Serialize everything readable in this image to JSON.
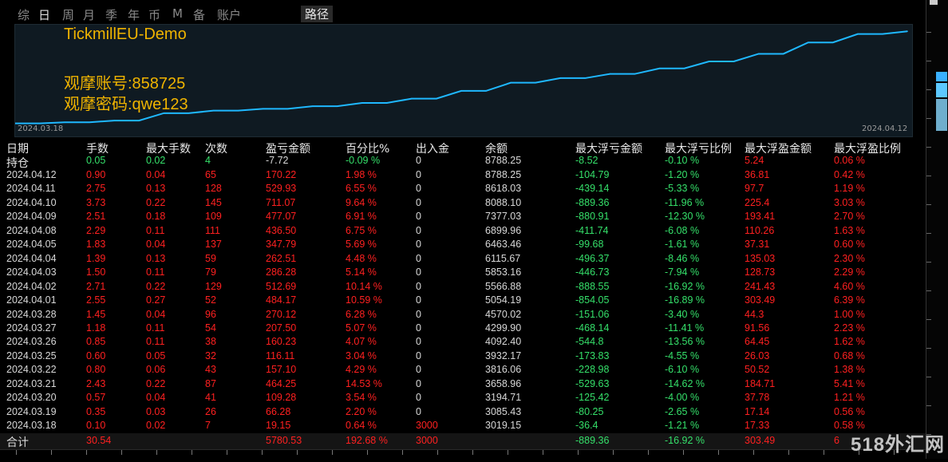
{
  "tabs": [
    "综",
    "日",
    "周",
    "月",
    "季",
    "年",
    "币",
    "M",
    "备",
    "账户"
  ],
  "active_tab": "日",
  "path_tab": "路径",
  "chart": {
    "annotations": [
      "TickmillEU-Demo",
      "观摩账号:858725",
      "观摩密码:qwe123"
    ],
    "start_date": "2024.03.18",
    "end_date": "2024.04.12",
    "line_color": "#1fb8ff",
    "annotation_color": "#f0b400"
  },
  "chart_data": {
    "type": "line",
    "title": "",
    "xlabel": "",
    "ylabel": "",
    "x": [
      "2024.03.18",
      "2024.03.19",
      "2024.03.20",
      "2024.03.21",
      "2024.03.22",
      "2024.03.25",
      "2024.03.26",
      "2024.03.27",
      "2024.03.28",
      "2024.04.01",
      "2024.04.02",
      "2024.04.03",
      "2024.04.04",
      "2024.04.05",
      "2024.04.08",
      "2024.04.09",
      "2024.04.10",
      "2024.04.11",
      "2024.04.12"
    ],
    "series": [
      {
        "values": [
          3019.15,
          3085.43,
          3194.71,
          3658.96,
          3816.06,
          3932.17,
          4092.4,
          4299.9,
          4570.02,
          5054.19,
          5566.88,
          5853.16,
          6115.67,
          6463.46,
          6899.96,
          7377.03,
          8088.1,
          8618.03,
          8788.25
        ]
      }
    ],
    "ylim": [
      2900,
      8900
    ],
    "grid": false
  },
  "table": {
    "headers": [
      "日期",
      "手数",
      "最大手数",
      "次数",
      "盈亏金额",
      "百分比%",
      "出入金",
      "余额",
      "最大浮亏金额",
      "最大浮亏比例",
      "最大浮盈金额",
      "最大浮盈比例"
    ],
    "holding": [
      "持仓",
      "0.05",
      "0.02",
      "4",
      "-7.72",
      "-0.09 %",
      "0",
      "8788.25",
      "-8.52",
      "-0.10 %",
      "5.24",
      "0.06 %"
    ],
    "rows": [
      [
        "2024.04.12",
        "0.90",
        "0.04",
        "65",
        "170.22",
        "1.98 %",
        "0",
        "8788.25",
        "-104.79",
        "-1.20 %",
        "36.81",
        "0.42 %"
      ],
      [
        "2024.04.11",
        "2.75",
        "0.13",
        "128",
        "529.93",
        "6.55 %",
        "0",
        "8618.03",
        "-439.14",
        "-5.33 %",
        "97.7",
        "1.19 %"
      ],
      [
        "2024.04.10",
        "3.73",
        "0.22",
        "145",
        "711.07",
        "9.64 %",
        "0",
        "8088.10",
        "-889.36",
        "-11.96 %",
        "225.4",
        "3.03 %"
      ],
      [
        "2024.04.09",
        "2.51",
        "0.18",
        "109",
        "477.07",
        "6.91 %",
        "0",
        "7377.03",
        "-880.91",
        "-12.30 %",
        "193.41",
        "2.70 %"
      ],
      [
        "2024.04.08",
        "2.29",
        "0.11",
        "111",
        "436.50",
        "6.75 %",
        "0",
        "6899.96",
        "-411.74",
        "-6.08 %",
        "110.26",
        "1.63 %"
      ],
      [
        "2024.04.05",
        "1.83",
        "0.04",
        "137",
        "347.79",
        "5.69 %",
        "0",
        "6463.46",
        "-99.68",
        "-1.61 %",
        "37.31",
        "0.60 %"
      ],
      [
        "2024.04.04",
        "1.39",
        "0.13",
        "59",
        "262.51",
        "4.48 %",
        "0",
        "6115.67",
        "-496.37",
        "-8.46 %",
        "135.03",
        "2.30 %"
      ],
      [
        "2024.04.03",
        "1.50",
        "0.11",
        "79",
        "286.28",
        "5.14 %",
        "0",
        "5853.16",
        "-446.73",
        "-7.94 %",
        "128.73",
        "2.29 %"
      ],
      [
        "2024.04.02",
        "2.71",
        "0.22",
        "129",
        "512.69",
        "10.14 %",
        "0",
        "5566.88",
        "-888.55",
        "-16.92 %",
        "241.43",
        "4.60 %"
      ],
      [
        "2024.04.01",
        "2.55",
        "0.27",
        "52",
        "484.17",
        "10.59 %",
        "0",
        "5054.19",
        "-854.05",
        "-16.89 %",
        "303.49",
        "6.39 %"
      ],
      [
        "2024.03.28",
        "1.45",
        "0.04",
        "96",
        "270.12",
        "6.28 %",
        "0",
        "4570.02",
        "-151.06",
        "-3.40 %",
        "44.3",
        "1.00 %"
      ],
      [
        "2024.03.27",
        "1.18",
        "0.11",
        "54",
        "207.50",
        "5.07 %",
        "0",
        "4299.90",
        "-468.14",
        "-11.41 %",
        "91.56",
        "2.23 %"
      ],
      [
        "2024.03.26",
        "0.85",
        "0.11",
        "38",
        "160.23",
        "4.07 %",
        "0",
        "4092.40",
        "-544.8",
        "-13.56 %",
        "64.45",
        "1.62 %"
      ],
      [
        "2024.03.25",
        "0.60",
        "0.05",
        "32",
        "116.11",
        "3.04 %",
        "0",
        "3932.17",
        "-173.83",
        "-4.55 %",
        "26.03",
        "0.68 %"
      ],
      [
        "2024.03.22",
        "0.80",
        "0.06",
        "43",
        "157.10",
        "4.29 %",
        "0",
        "3816.06",
        "-228.98",
        "-6.10 %",
        "50.52",
        "1.38 %"
      ],
      [
        "2024.03.21",
        "2.43",
        "0.22",
        "87",
        "464.25",
        "14.53 %",
        "0",
        "3658.96",
        "-529.63",
        "-14.62 %",
        "184.71",
        "5.41 %"
      ],
      [
        "2024.03.20",
        "0.57",
        "0.04",
        "41",
        "109.28",
        "3.54 %",
        "0",
        "3194.71",
        "-125.42",
        "-4.00 %",
        "37.78",
        "1.21 %"
      ],
      [
        "2024.03.19",
        "0.35",
        "0.03",
        "26",
        "66.28",
        "2.20 %",
        "0",
        "3085.43",
        "-80.25",
        "-2.65 %",
        "17.14",
        "0.56 %"
      ],
      [
        "2024.03.18",
        "0.10",
        "0.02",
        "7",
        "19.15",
        "0.64 %",
        "3000",
        "3019.15",
        "-36.4",
        "-1.21 %",
        "17.33",
        "0.58 %"
      ]
    ],
    "total": [
      "合计",
      "30.54",
      "",
      "",
      "5780.53",
      "192.68 %",
      "3000",
      "",
      "-889.36",
      "-16.92 %",
      "303.49",
      "6"
    ]
  },
  "colors": {
    "white": "#d8d8d8",
    "red": "#ff2020",
    "green": "#35e06a"
  },
  "watermark": "518外汇网"
}
